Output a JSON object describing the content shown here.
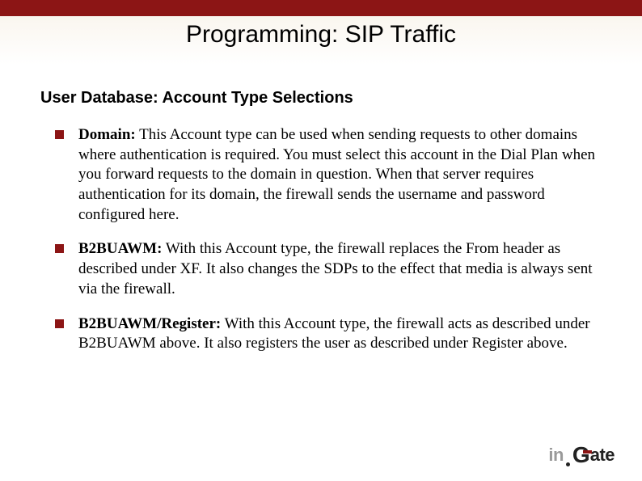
{
  "title": "Programming: SIP Traffic",
  "subtitle": "User Database:  Account Type Selections",
  "bullets": [
    {
      "label": "Domain:",
      "text": "  This Account type can be used when sending requests to other domains where authentication is required. You must select this account in the Dial Plan when you forward requests to the domain in question. When that server requires authentication for its domain, the firewall sends the username and password configured here."
    },
    {
      "label": "B2BUAWM:",
      "text": "  With this Account type, the firewall replaces the From header as described under XF. It also changes the SDPs to the effect that media is always sent via the firewall."
    },
    {
      "label": "B2BUAWM/Register:",
      "text": "  With this Account type, the firewall acts as described under B2BUAWM above. It also registers the user as described under Register above."
    }
  ],
  "logo": {
    "part1": "in",
    "part2": "G",
    "part3": "ate"
  }
}
